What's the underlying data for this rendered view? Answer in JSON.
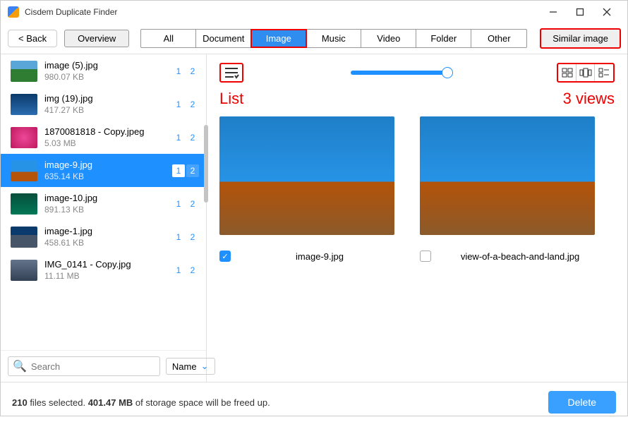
{
  "app": {
    "title": "Cisdem Duplicate Finder"
  },
  "nav": {
    "back": "< Back",
    "overview": "Overview",
    "tabs": [
      "All",
      "Document",
      "Image",
      "Music",
      "Video",
      "Folder",
      "Other"
    ],
    "activeTab": 2,
    "similar": "Similar image"
  },
  "files": [
    {
      "name": "image (5).jpg",
      "size": "980.07 KB",
      "b1": "1",
      "b2": "2",
      "th": "t1",
      "sel": false
    },
    {
      "name": "img (19).jpg",
      "size": "417.27 KB",
      "b1": "1",
      "b2": "2",
      "th": "t2",
      "sel": false
    },
    {
      "name": "1870081818 - Copy.jpeg",
      "size": "5.03 MB",
      "b1": "1",
      "b2": "2",
      "th": "t3",
      "sel": false
    },
    {
      "name": "image-9.jpg",
      "size": "635.14 KB",
      "b1": "1",
      "b2": "2",
      "th": "t4",
      "sel": true
    },
    {
      "name": "image-10.jpg",
      "size": "891.13 KB",
      "b1": "1",
      "b2": "2",
      "th": "t5",
      "sel": false
    },
    {
      "name": "image-1.jpg",
      "size": "458.61 KB",
      "b1": "1",
      "b2": "2",
      "th": "t6",
      "sel": false
    },
    {
      "name": "IMG_0141 - Copy.jpg",
      "size": "11.11 MB",
      "b1": "1",
      "b2": "2",
      "th": "t7",
      "sel": false
    }
  ],
  "search": {
    "placeholder": "Search"
  },
  "sort": {
    "label": "Name"
  },
  "annotations": {
    "list": "List",
    "views": "3 views"
  },
  "previews": [
    {
      "name": "image-9.jpg",
      "checked": true
    },
    {
      "name": "view-of-a-beach-and-land.jpg",
      "checked": false
    }
  ],
  "footer": {
    "count": "210",
    "t1": " files selected.  ",
    "size": "401.47 MB",
    "t2": "  of storage space will be freed up.",
    "delete": "Delete"
  }
}
